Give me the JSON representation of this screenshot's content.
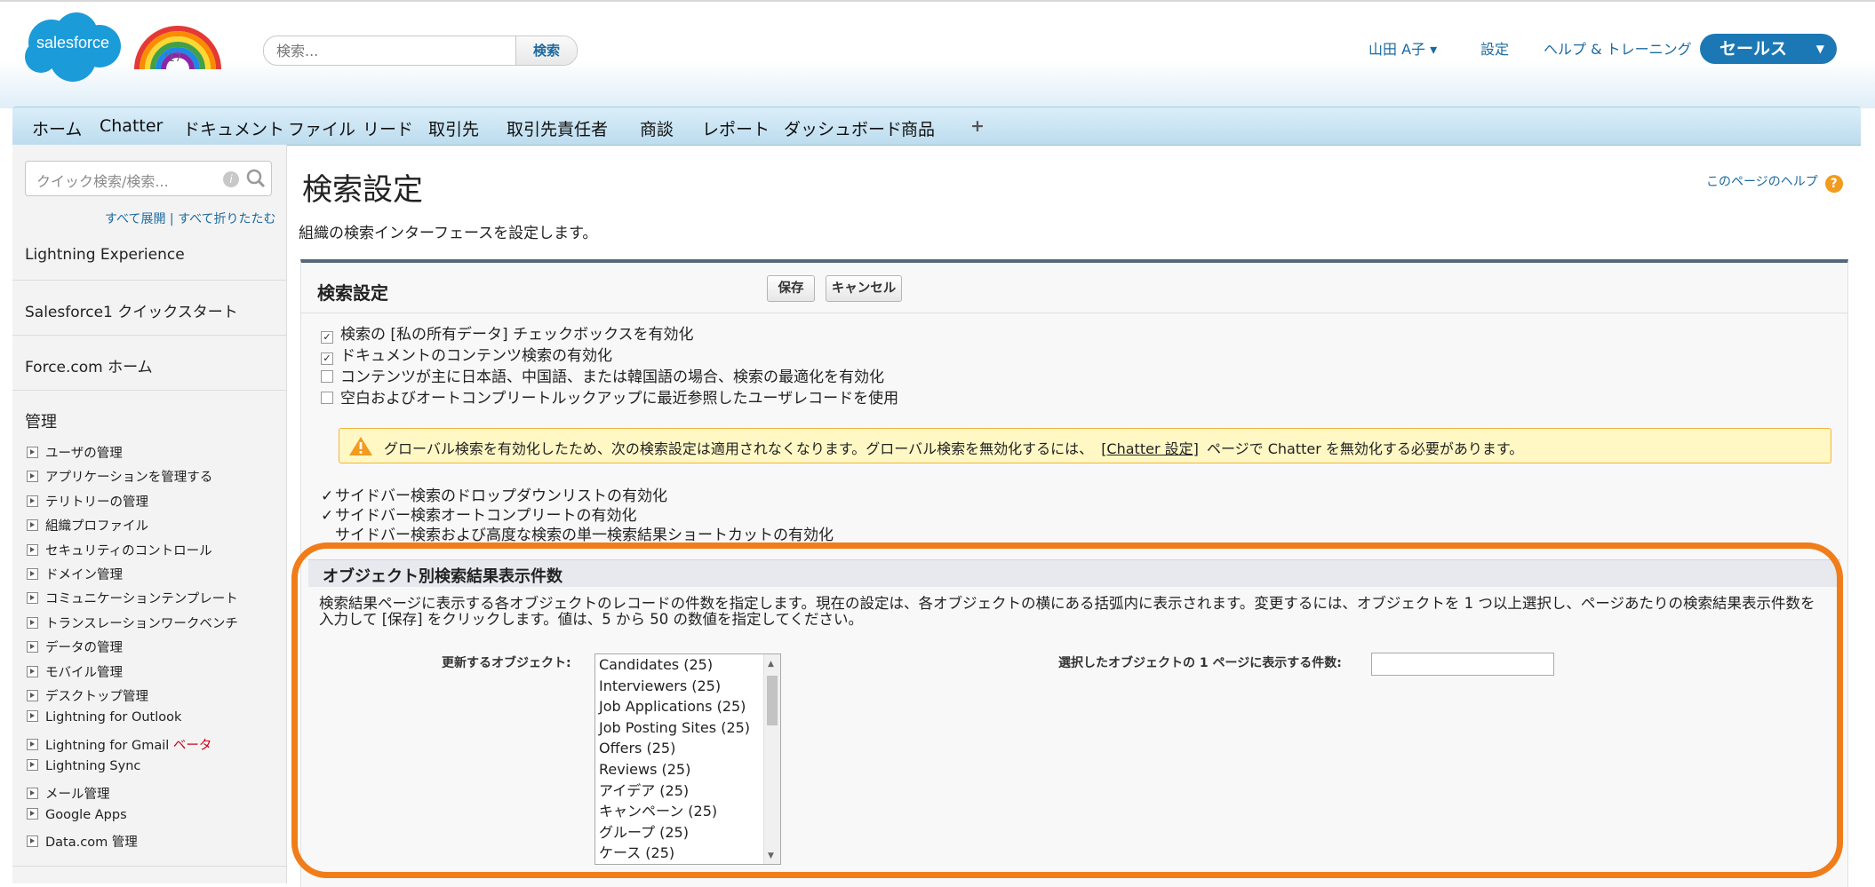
{
  "header": {
    "logo_text": "salesforce",
    "logo_badge": "'17",
    "search_placeholder": "検索...",
    "search_button": "検索",
    "user_menu": "山田 A子 ▾",
    "settings": "設定",
    "help_training": "ヘルプ & トレーニング",
    "app_switcher": "セールス"
  },
  "tabs": [
    "ホーム",
    "Chatter",
    "ドキュメント",
    "ファイル",
    "リード",
    "取引先",
    "取引先責任者",
    "商談",
    "レポート",
    "ダッシュボード",
    "商品",
    "+"
  ],
  "sidebar": {
    "quick_search_placeholder": "クイック検索/検索...",
    "expand_links": "すべて展開 | すべて折りたたむ",
    "items": [
      "Lightning Experience",
      "Salesforce1 クイックスタート",
      "Force.com ホーム"
    ],
    "admin_title": "管理",
    "admin_items": [
      "ユーザの管理",
      "アプリケーションを管理する",
      "テリトリーの管理",
      "組織プロファイル",
      "セキュリティのコントロール",
      "ドメイン管理",
      "コミュニケーションテンプレート",
      "トランスレーションワークベンチ",
      "データの管理",
      "モバイル管理",
      "デスクトップ管理",
      "Lightning for Outlook",
      "Lightning for Gmail",
      "Lightning Sync",
      "メール管理",
      "Google Apps",
      "Data.com 管理"
    ],
    "beta_label": "ベータ"
  },
  "main": {
    "title": "検索設定",
    "description": "組織の検索インターフェースを設定します。",
    "page_help": "このページのヘルプ"
  },
  "panel": {
    "title": "検索設定",
    "save": "保存",
    "cancel": "キャンセル",
    "checkboxes": [
      {
        "label": "検索の [私の所有データ] チェックボックスを有効化",
        "checked": true
      },
      {
        "label": "ドキュメントのコンテンツ検索の有効化",
        "checked": true
      },
      {
        "label": "コンテンツが主に日本語、中国語、または韓国語の場合、検索の最適化を有効化",
        "checked": false
      },
      {
        "label": "空白およびオートコンプリートルックアップに最近参照したユーザレコードを使用",
        "checked": false
      }
    ],
    "warning_text": "グローバル検索を有効化したため、次の検索設定は適用されなくなります。グローバル検索を無効化するには、",
    "warning_link": "[Chatter 設定]",
    "warning_text_after": "ページで Chatter を無効化する必要があります。",
    "sidebar_options": [
      {
        "label": "サイドバー検索のドロップダウンリストの有効化",
        "checked": true
      },
      {
        "label": "サイドバー検索オートコンプリートの有効化",
        "checked": true
      },
      {
        "label": "サイドバー検索および高度な検索の単一検索結果ショートカットの有効化",
        "checked": false
      }
    ]
  },
  "results_section": {
    "title": "オブジェクト別検索結果表示件数",
    "description": "検索結果ページに表示する各オブジェクトのレコードの件数を指定します。現在の設定は、各オブジェクトの横にある括弧内に表示されます。変更するには、オブジェクトを 1 つ以上選択し、ページあたりの検索結果表示件数を入力して [保存] をクリックします。値は、5 から 50 の数値を指定してください。",
    "objects_label": "更新するオブジェクト:",
    "count_label": "選択したオブジェクトの 1 ページに表示する件数:",
    "objects": [
      "Candidates (25)",
      "Interviewers (25)",
      "Job Applications (25)",
      "Job Posting Sites (25)",
      "Offers (25)",
      "Reviews (25)",
      "アイデア (25)",
      "キャンペーン (25)",
      "グループ (25)",
      "ケース (25)"
    ],
    "count_value": ""
  },
  "colors": {
    "brand_blue": "#1b78b4",
    "highlight_orange": "#f07d1a",
    "warning_bg": "#fff8c5"
  }
}
